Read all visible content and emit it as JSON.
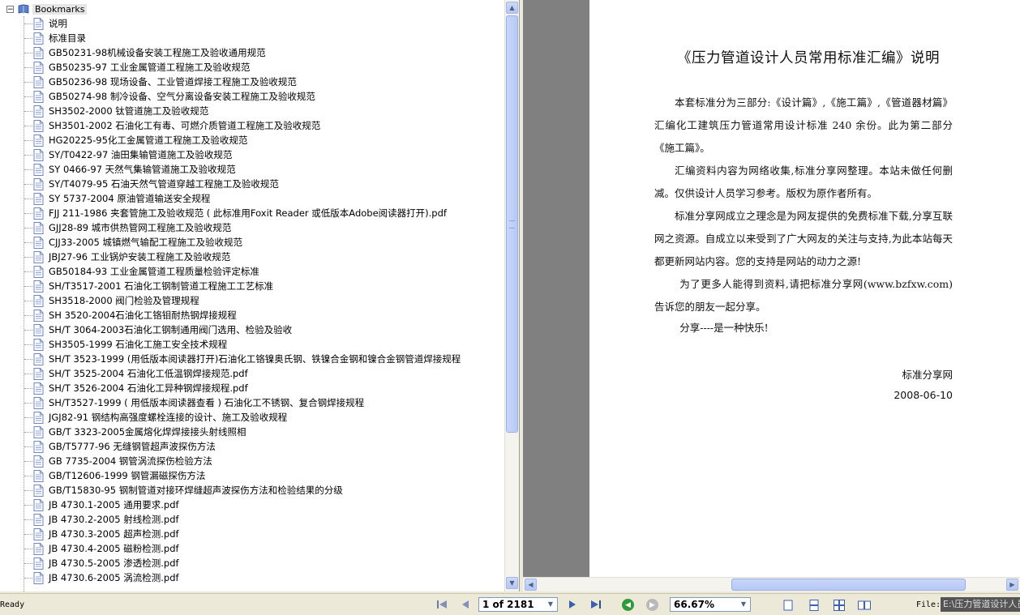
{
  "bookmarks": {
    "root_label": "Bookmarks",
    "expander_symbol": "−",
    "items": [
      {
        "label": "说明"
      },
      {
        "label": "标准目录"
      },
      {
        "label": "GB50231-98机械设备安装工程施工及验收通用规范"
      },
      {
        "label": "GB50235-97 工业金属管道工程施工及验收规范"
      },
      {
        "label": "GB50236-98 现场设备、工业管道焊接工程施工及验收规范"
      },
      {
        "label": "GB50274-98 制冷设备、空气分离设备安装工程施工及验收规范"
      },
      {
        "label": "SH3502-2000 钛管道施工及验收规范"
      },
      {
        "label": "SH3501-2002 石油化工有毒、可燃介质管道工程施工及验收规范"
      },
      {
        "label": "HG20225-95化工金属管道工程施工及验收规范"
      },
      {
        "label": "SY/T0422-97 油田集输管道施工及验收规范"
      },
      {
        "label": "SY 0466-97 天然气集输管道施工及验收规范"
      },
      {
        "label": "SY/T4079-95 石油天然气管道穿越工程施工及验收规范"
      },
      {
        "label": "SY 5737-2004 原油管道输送安全规程"
      },
      {
        "label": "FJJ 211-1986 夹套管施工及验收规范 ( 此标准用Foxit Reader 或低版本Adobe阅读器打开).pdf"
      },
      {
        "label": "GJJ28-89 城市供热管网工程施工及验收规范"
      },
      {
        "label": "CJJ33-2005 城镇燃气输配工程施工及验收规范"
      },
      {
        "label": "JBJ27-96 工业锅炉安装工程施工及验收规范"
      },
      {
        "label": "GB50184-93 工业金属管道工程质量检验评定标准"
      },
      {
        "label": "SH/T3517-2001 石油化工钢制管道工程施工工艺标准"
      },
      {
        "label": "SH3518-2000 阀门检验及管理规程"
      },
      {
        "label": "SH 3520-2004石油化工铬钼耐热钢焊接规程"
      },
      {
        "label": "SH/T 3064-2003石油化工钢制通用阀门选用、检验及验收"
      },
      {
        "label": "SH3505-1999 石油化工施工安全技术规程"
      },
      {
        "label": "SH/T 3523-1999 (用低版本阅读器打开)石油化工铬镍奥氏钢、铁镍合金钢和镍合金钢管道焊接规程"
      },
      {
        "label": "SH/T 3525-2004 石油化工低温钢焊接规范.pdf"
      },
      {
        "label": "SH/T 3526-2004 石油化工异种钢焊接规程.pdf"
      },
      {
        "label": "SH/T3527-1999 ( 用低版本阅读器查看 ) 石油化工不锈钢、复合钢焊接规程"
      },
      {
        "label": "JGJ82-91 钢结构高强度螺栓连接的设计、施工及验收规程"
      },
      {
        "label": "GB/T 3323-2005金属熔化焊焊接接头射线照相"
      },
      {
        "label": "GB/T5777-96 无缝钢管超声波探伤方法"
      },
      {
        "label": "GB 7735-2004 钢管涡流探伤检验方法"
      },
      {
        "label": "GB/T12606-1999 钢管漏磁探伤方法"
      },
      {
        "label": "GB/T15830-95 钢制管道对接环焊缝超声波探伤方法和检验结果的分级"
      },
      {
        "label": "JB 4730.1-2005 通用要求.pdf"
      },
      {
        "label": "JB 4730.2-2005 射线检测.pdf"
      },
      {
        "label": "JB 4730.3-2005 超声检测.pdf"
      },
      {
        "label": "JB 4730.4-2005 磁粉检测.pdf"
      },
      {
        "label": "JB 4730.5-2005 渗透检测.pdf"
      },
      {
        "label": "JB 4730.6-2005 涡流检测.pdf"
      }
    ]
  },
  "document": {
    "title": "《压力管道设计人员常用标准汇编》说明",
    "paragraphs": [
      "本套标准分为三部分:《设计篇》,《施工篇》,《管道器材篇》 汇编化工建筑压力管道常用设计标准 240 余份。此为第二部分《施工篇》。",
      "汇编资料内容为网络收集,标准分享网整理。本站未做任何删减。仅供设计人员学习参考。版权为原作者所有。",
      "标准分享网成立之理念是为网友提供的免费标准下载,分享互联网之资源。自成立以来受到了广大网友的关注与支持,为此本站每天都更新网站内容。您的支持是网站的动力之源!",
      "为了更多人能得到资料,请把标准分享网(www.bzfxw.com)告诉您的朋友一起分享。",
      "分享----是一种快乐!"
    ],
    "signature": "标准分享网",
    "date": "2008-06-10"
  },
  "status_bar": {
    "status_text": "Ready",
    "page_display": "1 of 2181",
    "zoom_display": "66.67%",
    "file_label": "File:",
    "file_value": "E:\\压力管道设计人员"
  },
  "icons": {
    "first_page": "first-page-icon",
    "prev_page": "previous-page-icon",
    "next_page": "next-page-icon",
    "last_page": "last-page-icon",
    "back": "back-arrow-icon",
    "forward": "forward-arrow-icon",
    "single_page": "single-page-view-icon",
    "continuous": "continuous-view-icon",
    "facing": "facing-view-icon",
    "continuous_facing": "continuous-facing-view-icon"
  },
  "colors": {
    "accent_green": "#2f9a3a",
    "gray_button": "#b9b9b9",
    "doc_background": "#808080",
    "scroll_thumb": "#b7c9f6"
  }
}
